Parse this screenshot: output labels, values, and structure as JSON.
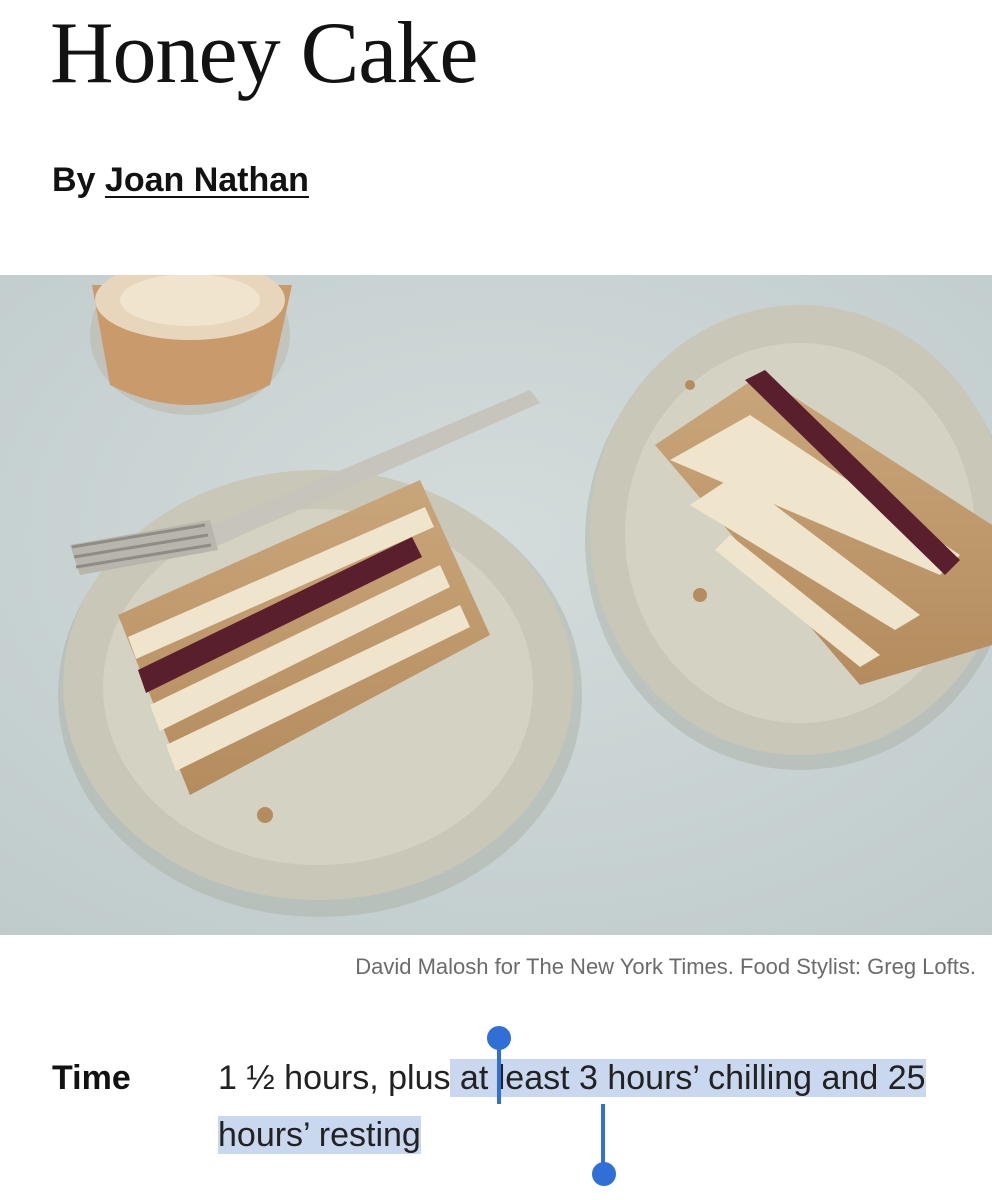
{
  "recipe": {
    "title": "Honey Cake",
    "byline_prefix": "By",
    "author": "Joan Nathan"
  },
  "photo": {
    "subject": "two slices of layered honey cake with jam on plates, fork, and latte",
    "caption": "David Malosh for The New York Times. Food Stylist: Greg Lofts."
  },
  "details": {
    "time_label": "Time",
    "time_unselected": "1 ½ hours, plus",
    "time_selected": " at least 3 hours’ chilling and 25 hours’ resting"
  },
  "selection": {
    "highlight_color": "#c9d8ee",
    "handle_color": "#2f6fd6"
  }
}
